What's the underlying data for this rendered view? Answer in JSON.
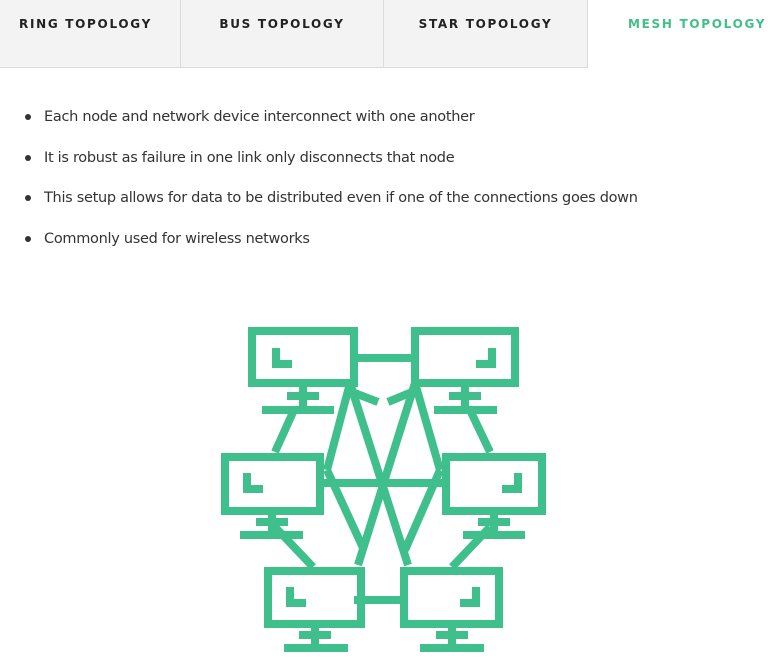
{
  "tabs": [
    {
      "label": "RING TOPOLOGY",
      "active": false
    },
    {
      "label": "BUS TOPOLOGY",
      "active": false
    },
    {
      "label": "STAR TOPOLOGY",
      "active": false
    },
    {
      "label": "MESH TOPOLOGY",
      "active": true
    }
  ],
  "bullets": [
    "Each node and network device interconnect with one another",
    "It is robust as failure in one link only disconnects that node",
    "This setup allows for data to be distributed even if one of the connections goes down",
    "Commonly used for wireless networks"
  ],
  "diagram": {
    "icon": "mesh-network-icon",
    "node_count": 6
  },
  "colors": {
    "accent": "#3fbf8b",
    "tab_bg": "#f3f3f3",
    "tab_text": "#222222",
    "body_text": "#333333"
  }
}
